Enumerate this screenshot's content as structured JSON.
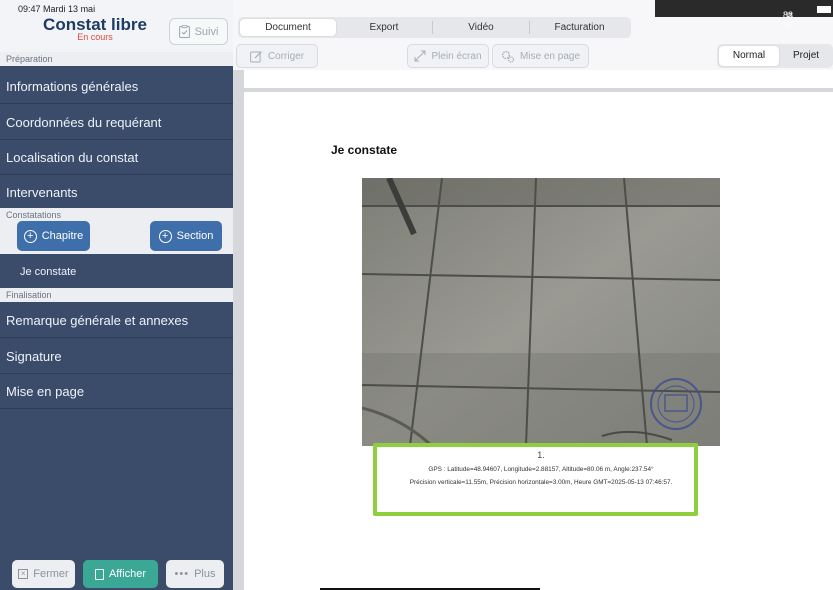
{
  "status_bar": {
    "time": "09:47",
    "date": "Mardi 13 mai",
    "battery": "83 %"
  },
  "app": {
    "title": "Constat libre",
    "status": "En cours",
    "suivi_label": "Suivi"
  },
  "sidebar": {
    "sections": {
      "preparation": "Préparation",
      "constatations": "Constatations",
      "finalisation": "Finalisation"
    },
    "items": [
      "Informations générales",
      "Coordonnées du requérant",
      "Localisation du constat",
      "Intervenants"
    ],
    "chapter_button": "Chapitre",
    "section_button": "Section",
    "sub_item": "Je constate",
    "final_items": [
      "Remarque générale et annexes",
      "Signature",
      "Mise en page"
    ],
    "footer": {
      "close": "Fermer",
      "show": "Afficher",
      "more": "Plus"
    }
  },
  "tabs": [
    "Document",
    "Export",
    "Vidéo",
    "Facturation"
  ],
  "toolbar": {
    "correct": "Corriger",
    "fullscreen": "Plein écran",
    "layout": "Mise en page"
  },
  "modes": [
    "Normal",
    "Projet"
  ],
  "document": {
    "heading": "Je constate",
    "caption_number": "1.",
    "caption_line1": "GPS : Latitude=48.94607, Longitude=2.88157, Altitude=80.06 m, Angle:237.54°",
    "caption_line2": "Précision verticale=11.55m, Précision horizontale=3.00m, Heure GMT=2025-05-13 07:46:57."
  },
  "colors": {
    "sidebar": "#3b4c6b",
    "accent_blue": "#3f6fab",
    "accent_green": "#3aa895",
    "highlight": "#8fcf3e",
    "status_red": "#d64a3c"
  }
}
